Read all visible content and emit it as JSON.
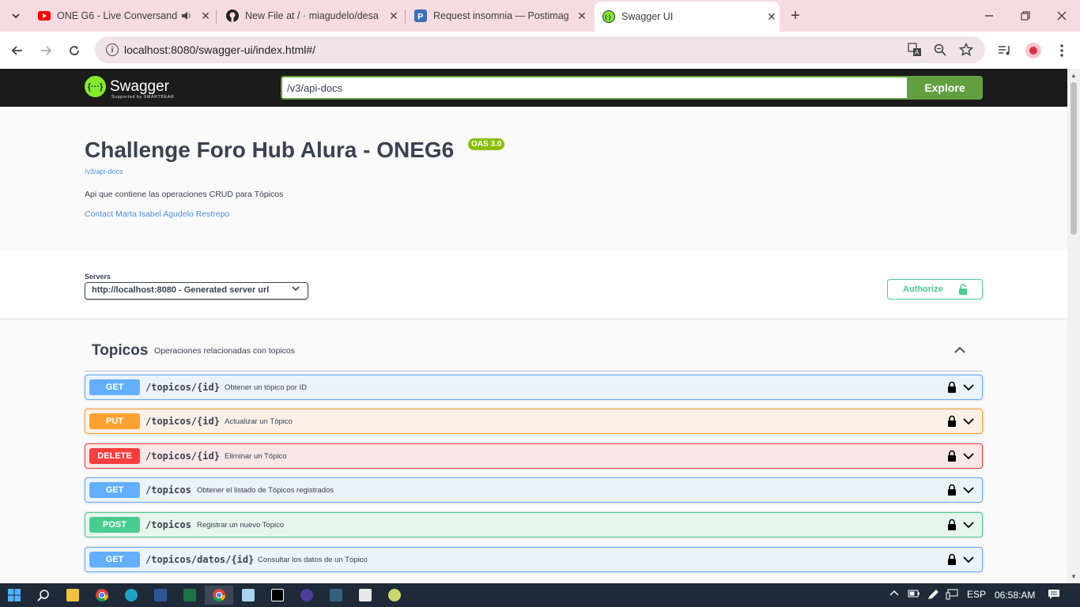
{
  "browser": {
    "tabs": [
      {
        "title": "ONE G6 - Live Conversando",
        "favicon": "youtube-icon"
      },
      {
        "title": "New File at / · miagudelo/desa",
        "favicon": "github-icon"
      },
      {
        "title": "Request insomnia — Postimage",
        "favicon": "postimages-icon"
      },
      {
        "title": "Swagger UI",
        "favicon": "swagger-icon"
      }
    ],
    "url": "localhost:8080/swagger-ui/index.html#/"
  },
  "swagger": {
    "brand": "Swagger",
    "brand_sub": "Supported by SMARTBEAR",
    "spec_url": "/v3/api-docs",
    "explore_label": "Explore"
  },
  "info": {
    "title": "Challenge Foro Hub Alura - ONEG6",
    "oas_version": "OAS 3.0",
    "url": "/v3/api-docs",
    "description": "Api que contiene las operaciones CRUD para Tópicos",
    "contact": "Contact Marta Isabel Agudelo Restrepo"
  },
  "servers": {
    "label": "Servers",
    "selected": "http://localhost:8080 - Generated server url",
    "authorize_label": "Authorize"
  },
  "tag": {
    "name": "Topicos",
    "description": "Operaciones relacionadas con topicos"
  },
  "operations": [
    {
      "method": "GET",
      "path": "/topicos/{id}",
      "summary": "Obtener un tópico por ID"
    },
    {
      "method": "PUT",
      "path": "/topicos/{id}",
      "summary": "Actualizar un Tópico"
    },
    {
      "method": "DELETE",
      "path": "/topicos/{id}",
      "summary": "Eliminar un Tópico"
    },
    {
      "method": "GET",
      "path": "/topicos",
      "summary": "Obtener el listado de Tópicos registrados"
    },
    {
      "method": "POST",
      "path": "/topicos",
      "summary": "Registrar un nuevo Topico"
    },
    {
      "method": "GET",
      "path": "/topicos/datos/{id}",
      "summary": "Consultar los datos de un Tópico"
    }
  ],
  "taskbar": {
    "language": "ESP",
    "time": "06:58:AM"
  },
  "colors": {
    "get": "#61affe",
    "put": "#fca130",
    "delete": "#f93e3e",
    "post": "#49cc90",
    "explore": "#62a03f"
  }
}
